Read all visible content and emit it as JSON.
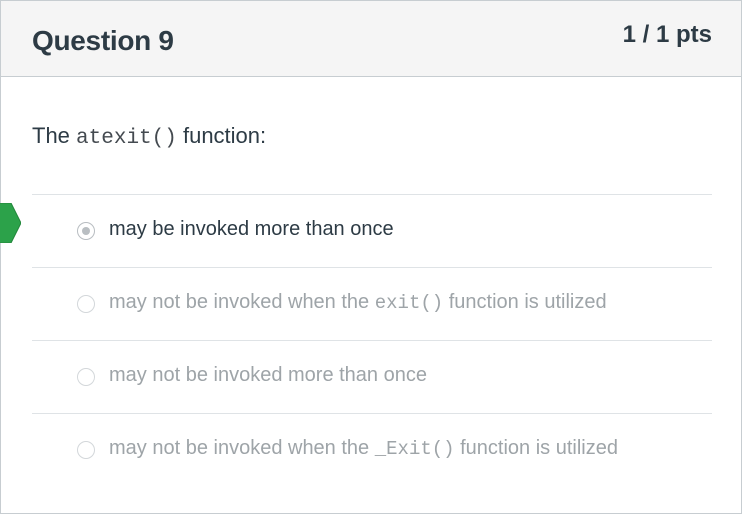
{
  "question": {
    "title": "Question 9",
    "points": "1 / 1 pts",
    "text_before": "The ",
    "text_code": "atexit()",
    "text_after": " function:"
  },
  "answers": [
    {
      "label_before": "may be invoked more than once",
      "label_code": "",
      "label_after": "",
      "selected": true,
      "correct": true
    },
    {
      "label_before": "may not be invoked when the ",
      "label_code": "exit()",
      "label_after": " function is utilized",
      "selected": false,
      "correct": false
    },
    {
      "label_before": "may not be invoked more than once",
      "label_code": "",
      "label_after": "",
      "selected": false,
      "correct": false
    },
    {
      "label_before": "may not be invoked when the ",
      "label_code": "_Exit()",
      "label_after": " function is utilized",
      "selected": false,
      "correct": false
    }
  ],
  "colors": {
    "correct_marker": "#2ca24a",
    "heading_text": "#2d3b45",
    "answer_text_muted": "#9ea4a8"
  },
  "icons": {
    "correct_marker": "correct-answer-arrow-icon"
  }
}
